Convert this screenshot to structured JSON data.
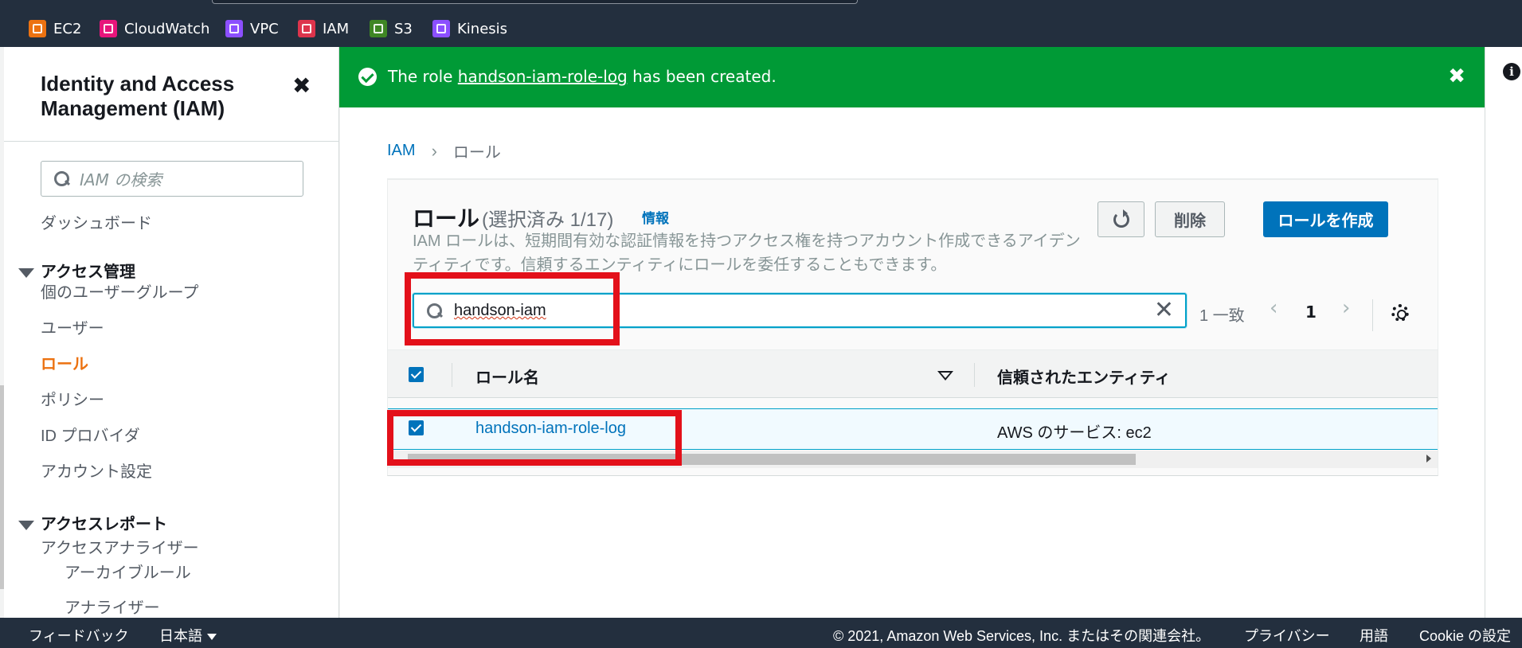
{
  "services": [
    {
      "label": "EC2",
      "icon": "ec2-icon",
      "color": "#ec7211"
    },
    {
      "label": "CloudWatch",
      "icon": "cloudwatch-icon",
      "color": "#e7157b"
    },
    {
      "label": "VPC",
      "icon": "vpc-icon",
      "color": "#8c4fff"
    },
    {
      "label": "IAM",
      "icon": "iam-icon",
      "color": "#dd344c"
    },
    {
      "label": "S3",
      "icon": "s3-icon",
      "color": "#3f8624"
    },
    {
      "label": "Kinesis",
      "icon": "kinesis-icon",
      "color": "#8c4fff"
    }
  ],
  "sidebar": {
    "title": "Identity and Access Management (IAM)",
    "search_placeholder": "IAM の検索",
    "dashboard": "ダッシュボード",
    "section_access": "アクセス管理",
    "items": [
      "個のユーザーグループ",
      "ユーザー",
      "ロール",
      "ポリシー",
      "ID プロバイダ",
      "アカウント設定"
    ],
    "active_item": "ロール",
    "section_reports": "アクセスレポート",
    "reports_items": [
      "アクセスアナライザー"
    ],
    "reports_sub": [
      "アーカイブルール",
      "アナライザー"
    ]
  },
  "flash": {
    "prefix": "The role",
    "role_link": "handson-iam-role-log",
    "suffix": "has been created."
  },
  "breadcrumb": {
    "root": "IAM",
    "current": "ロール"
  },
  "roles": {
    "heading": "ロール",
    "count": "(選択済み 1/17)",
    "info": "情報",
    "description": "IAM ロールは、短期間有効な認証情報を持つアクセス権を持つアカウント作成できるアイデンティティです。信頼するエンティティにロールを委任することもできます。",
    "delete_label": "削除",
    "create_label": "ロールを作成",
    "filter_value": "handson-iam",
    "matches": "1 一致",
    "page": "1",
    "columns": [
      "ロール名",
      "信頼されたエンティティ"
    ],
    "rows": [
      {
        "name": "handson-iam-role-log",
        "trusted": "AWS のサービス: ec2",
        "selected": true
      }
    ]
  },
  "footer": {
    "feedback": "フィードバック",
    "language": "日本語",
    "copyright": "© 2021, Amazon Web Services, Inc. またはその関連会社。",
    "privacy": "プライバシー",
    "terms": "用語",
    "cookie": "Cookie の設定"
  },
  "colors": {
    "success": "#009a36",
    "link": "#0073bb",
    "active_nav": "#ec7211",
    "annotation_red": "#e3101a",
    "header_bg": "#232f3e"
  }
}
